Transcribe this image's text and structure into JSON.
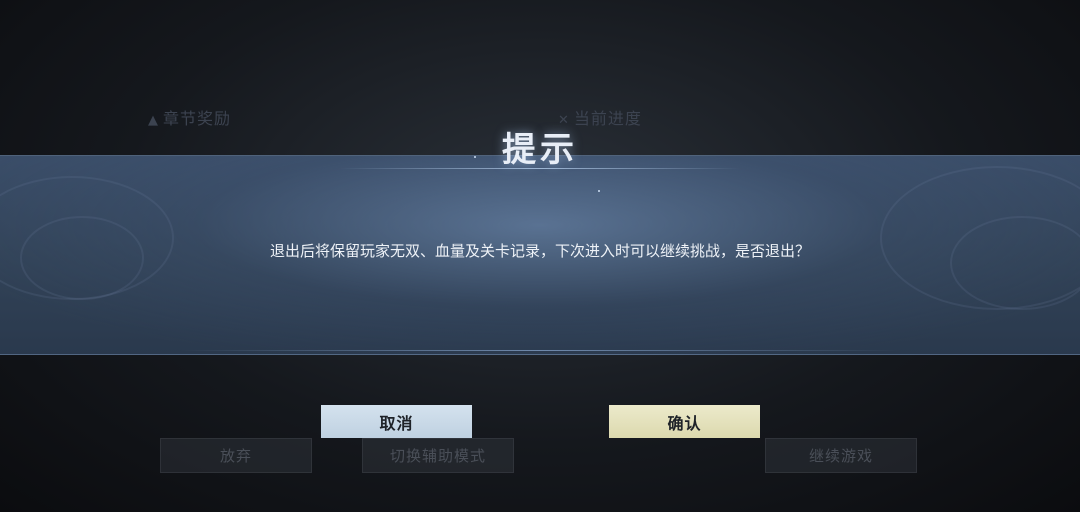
{
  "background": {
    "chapter_reward_label": "章节奖励",
    "current_progress_label": "当前进度",
    "buttons": {
      "give_up": "放弃",
      "switch_assist_mode": "切换辅助模式",
      "continue_game": "继续游戏"
    }
  },
  "dialog": {
    "title": "提示",
    "message": "退出后将保留玩家无双、血量及关卡记录，下次进入时可以继续挑战，是否退出？",
    "cancel_label": "取消",
    "confirm_label": "确认"
  },
  "colors": {
    "banner": "#324358",
    "cancel_button": "#c9d9e8",
    "confirm_button": "#e4e2bf",
    "title_text": "#e8eef7"
  }
}
